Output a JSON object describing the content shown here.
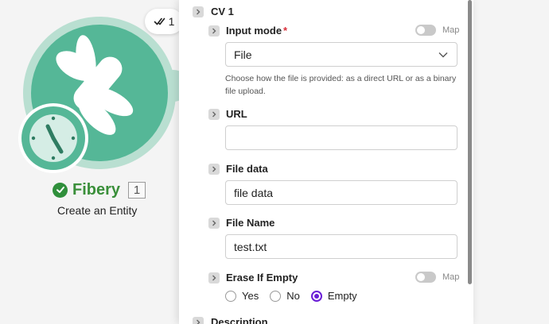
{
  "canvas": {
    "ops_count": "1",
    "module": {
      "name": "Fibery",
      "index": "1",
      "subtitle": "Create an Entity",
      "status": "success",
      "brand_color": "#55b797"
    }
  },
  "panel": {
    "section_top": {
      "label": "CV 1"
    },
    "fields": {
      "input_mode": {
        "label": "Input mode",
        "required_mark": "*",
        "map_label": "Map",
        "value": "File",
        "help": "Choose how the file is provided: as a direct URL or as a binary file upload."
      },
      "url": {
        "label": "URL",
        "value": ""
      },
      "file_data": {
        "label": "File data",
        "value": "file data"
      },
      "file_name": {
        "label": "File Name",
        "value": "test.txt"
      },
      "erase_if_empty": {
        "label": "Erase If Empty",
        "map_label": "Map",
        "options": [
          "Yes",
          "No",
          "Empty"
        ],
        "selected": "Empty"
      }
    },
    "section_bottom": {
      "label": "Description"
    },
    "colors": {
      "radio_accent": "#6a1fd6",
      "required": "#d9303a"
    }
  }
}
